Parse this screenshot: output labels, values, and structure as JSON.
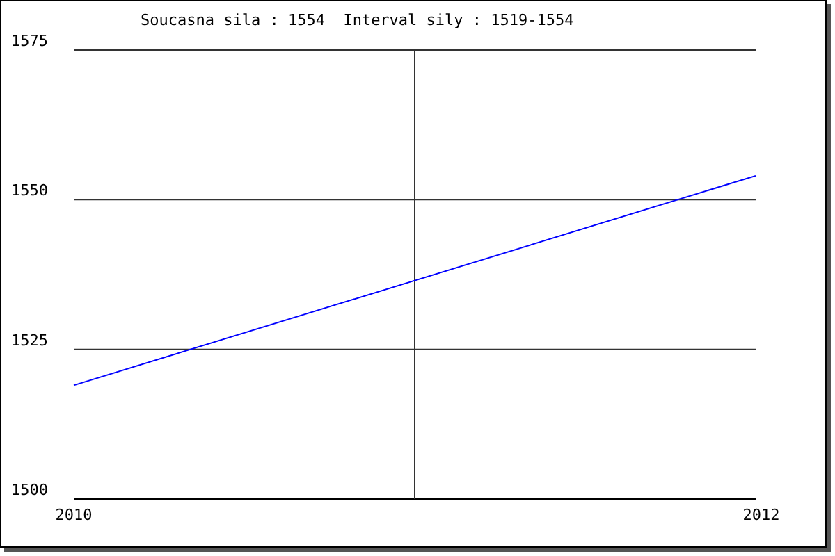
{
  "chart": {
    "chart_data": {
      "type": "line",
      "title": "Soucasna sila : 1554  Interval sily : 1519-1554",
      "x": [
        2010,
        2012
      ],
      "series": [
        {
          "color": "#0000ff",
          "values": [
            1519,
            1554
          ]
        }
      ],
      "xlim": [
        2010,
        2012
      ],
      "ylim": [
        1500,
        1575
      ],
      "xticks": [
        2010,
        2012
      ],
      "yticks": [
        1500,
        1525,
        1550,
        1575
      ]
    }
  }
}
